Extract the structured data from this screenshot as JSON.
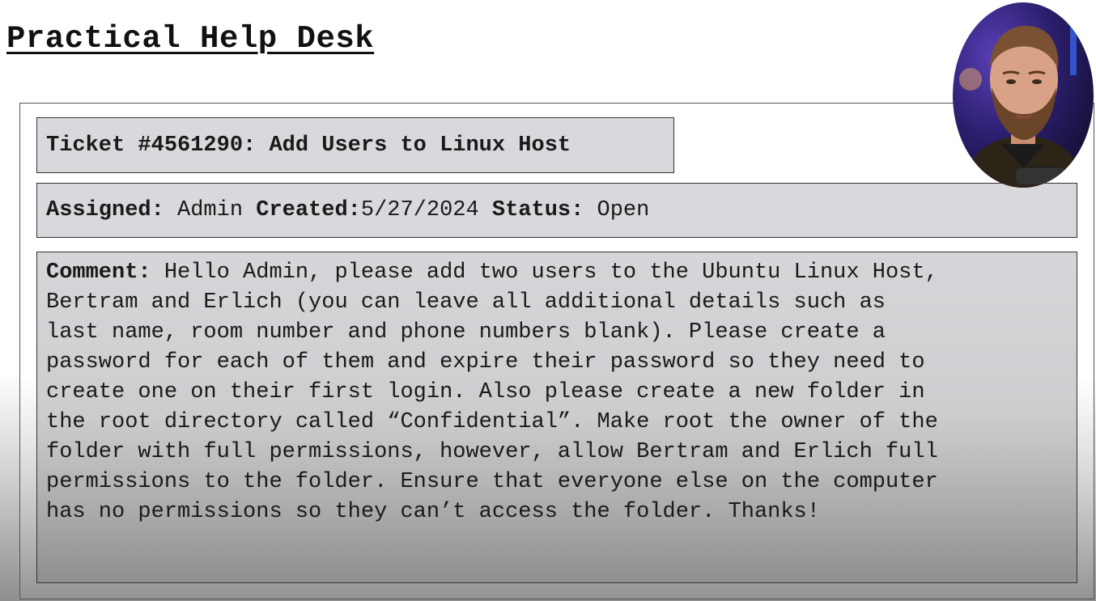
{
  "page": {
    "title": "Practical Help Desk"
  },
  "ticket": {
    "heading": "Ticket #4561290: Add Users to Linux Host"
  },
  "meta": {
    "assigned_label": "Assigned:",
    "assigned_value": " Admin ",
    "created_label": "Created:",
    "created_value": "5/27/2024 ",
    "status_label": "Status:",
    "status_value": " Open"
  },
  "comment": {
    "label": "Comment:",
    "lines": [
      " Hello Admin, please add two users to the Ubuntu Linux Host,",
      "Bertram and Erlich (you can leave all additional details such as",
      "last name, room number and phone numbers blank). Please create a",
      "password for each of them and expire their password so they need to",
      "create one on their first login. Also please create a new folder in",
      "the root directory called “Confidential”. Make root the owner of the",
      "folder with full permissions, however, allow Bertram and Erlich full",
      "permissions to the folder. Ensure that everyone else on the computer",
      "has no permissions so they can’t access the folder. Thanks!"
    ]
  },
  "webcam": {
    "icon": "presenter-webcam"
  }
}
